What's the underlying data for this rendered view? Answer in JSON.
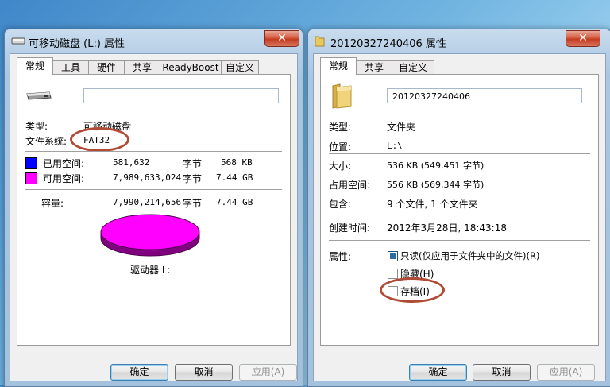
{
  "left_window": {
    "title": "可移动磁盘 (L:) 属性",
    "close_label": "✕",
    "tabs": [
      {
        "label": "常规"
      },
      {
        "label": "工具"
      },
      {
        "label": "硬件"
      },
      {
        "label": "共享"
      },
      {
        "label": "ReadyBoost"
      },
      {
        "label": "自定义"
      }
    ],
    "volume_name": "",
    "type_label": "类型:",
    "type_value": "可移动磁盘",
    "fs_label": "文件系统:",
    "fs_value": "FAT32",
    "used_label": "已用空间:",
    "used_bytes": "581,632",
    "used_unit": "字节",
    "used_size": "568 KB",
    "free_label": "可用空间:",
    "free_bytes": "7,989,633,024",
    "free_unit": "字节",
    "free_size": "7.44 GB",
    "capacity_label": "容量:",
    "capacity_bytes": "7,990,214,656",
    "capacity_unit": "字节",
    "capacity_size": "7.44 GB",
    "drive_label": "驱动器 L:",
    "used_color": "#0000ff",
    "free_color": "#ff00ff",
    "ok_label": "确定",
    "cancel_label": "取消",
    "apply_label": "应用(A)"
  },
  "right_window": {
    "title": "20120327240406 属性",
    "close_label": "✕",
    "tabs": [
      {
        "label": "常规"
      },
      {
        "label": "共享"
      },
      {
        "label": "自定义"
      }
    ],
    "folder_name": "20120327240406",
    "type_label": "类型:",
    "type_value": "文件夹",
    "location_label": "位置:",
    "location_value": "L:\\",
    "size_label": "大小:",
    "size_value": "536 KB (549,451 字节)",
    "disk_size_label": "占用空间:",
    "disk_size_value": "556 KB (569,344 字节)",
    "contains_label": "包含:",
    "contains_value": "9 个文件, 1 个文件夹",
    "created_label": "创建时间:",
    "created_value": "2012年3月28日, 18:43:18",
    "attributes_label": "属性:",
    "readonly_label": "只读(仅应用于文件夹中的文件)(R)",
    "hidden_label": "隐藏(H)",
    "archive_label": "存档(I)",
    "ok_label": "确定",
    "cancel_label": "取消",
    "apply_label": "应用(A)"
  }
}
